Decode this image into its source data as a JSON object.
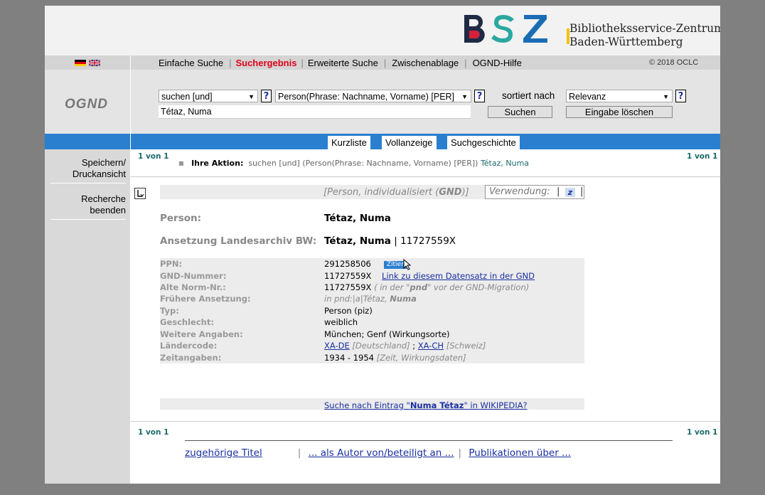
{
  "header": {
    "org_line1": "Bibliotheksservice-Zentrum",
    "org_line2": "Baden-Württemberg",
    "logo_letters": "BSZ"
  },
  "nav": {
    "items": [
      {
        "label": "Einfache Suche"
      },
      {
        "label": "Suchergebnis"
      },
      {
        "label": "Erweiterte Suche"
      },
      {
        "label": "Zwischenablage"
      },
      {
        "label": "OGND-Hilfe"
      }
    ],
    "active": "Suchergebnis",
    "copyright": "© 2018 OCLC"
  },
  "search": {
    "db_label": "OGND",
    "operator_value": "suchen [und]",
    "index_value": "Person(Phrase: Nachname, Vorname) [PER]",
    "sort_label": "sortiert nach",
    "sort_value": "Relevanz",
    "query_value": "Tétaz, Numa",
    "help_label": "?",
    "search_button": "Suchen",
    "clear_button": "Eingabe löschen"
  },
  "tabs": [
    {
      "label": "Kurzliste"
    },
    {
      "label": "Vollanzeige"
    },
    {
      "label": "Suchgeschichte"
    }
  ],
  "sidebar": {
    "save_line1": "Speichern/",
    "save_line2": "Druckansicht",
    "end_line1": "Recherche",
    "end_line2": "beenden"
  },
  "result": {
    "counter": "1 von 1",
    "aktion_label": "Ihre Aktion:",
    "aktion_query": "suchen [und] (Person(Phrase: Nachname, Vorname) [PER])",
    "aktion_term": "Tétaz, Numa",
    "type_prefix": "[Person, individualisiert (",
    "type_bold": "GND",
    "type_suffix": ")]",
    "verwendung_label": "Verwendung:",
    "verwendung_badge": "z",
    "person_label": "Person:",
    "person_value": "Tétaz, Numa",
    "ansetzung_label": "Ansetzung Landesarchiv BW:",
    "ansetzung_name": "Tétaz, Numa",
    "ansetzung_sep": "|",
    "ansetzung_id": "11727559X"
  },
  "details": {
    "ppn_label": "PPN:",
    "ppn_value": "291258506",
    "zitier": "Zitier",
    "gnd_label": "GND-Nummer:",
    "gnd_value": "11727559X",
    "gnd_link": "Link zu diesem Datensatz in der GND",
    "alte_label": "Alte Norm-Nr.:",
    "alte_value": "11727559X",
    "alte_note_1": "( in der \"",
    "alte_note_bold": "pnd",
    "alte_note_2": "\" vor der GND-Migration)",
    "frueher_label": "Frühere Ansetzung:",
    "frueher_prefix": "in pnd:|a|Tétaz, ",
    "frueher_bold": "Numa",
    "typ_label": "Typ:",
    "typ_value": "Person (piz)",
    "geschlecht_label": "Geschlecht:",
    "geschlecht_value": "weiblich",
    "weitere_label": "Weitere Angaben:",
    "weitere_value": "München; Genf (Wirkungsorte)",
    "laender_label": "Ländercode:",
    "laender_code1": "XA-DE",
    "laender_name1": "[Deutschland]",
    "laender_sep": ";",
    "laender_code2": "XA-CH",
    "laender_name2": "[Schweiz]",
    "zeit_label": "Zeitangaben:",
    "zeit_value": "1934 - 1954",
    "zeit_note": "[Zeit, Wirkungsdaten]"
  },
  "wiki": {
    "prefix": "Suche nach Eintrag \"",
    "name": "Numa Tétaz",
    "suffix": "\" in WIKIPEDIA?"
  },
  "bottom_links": [
    {
      "label": "zugehörige Titel"
    },
    {
      "label": "... als Autor von/beteiligt an ..."
    },
    {
      "label": "Publikationen über ..."
    }
  ],
  "bottom_sep": "|",
  "colors": {
    "accent_blue": "#2a7fcf",
    "active_red": "#e2001a",
    "teal": "#1b6a6a",
    "link": "#1a2fa0"
  }
}
